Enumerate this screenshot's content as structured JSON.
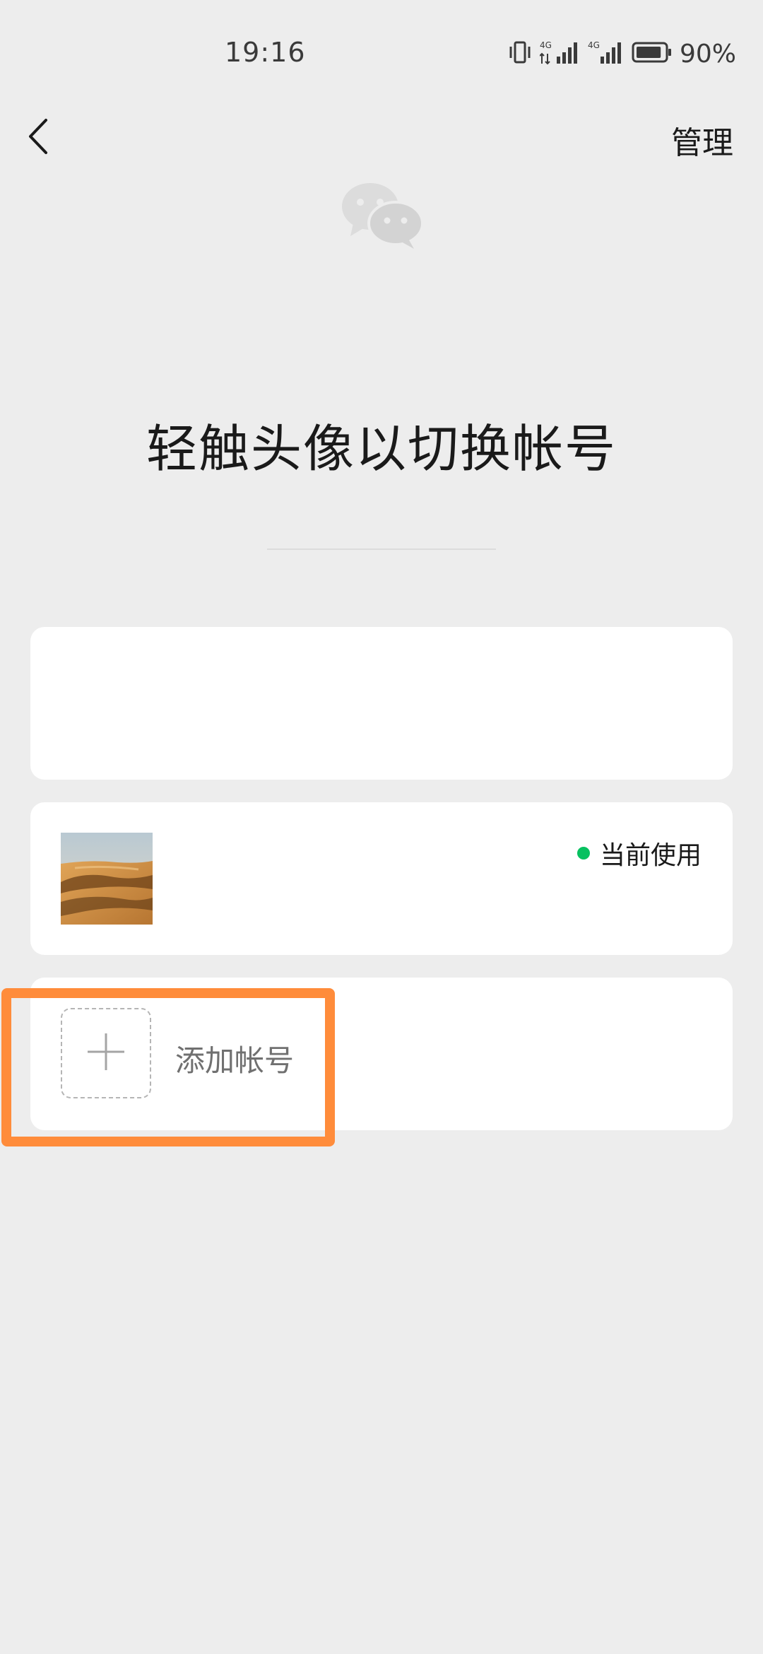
{
  "status_bar": {
    "time": "19:16",
    "signal_1_label": "4G",
    "signal_2_label": "4G",
    "battery_percent": "90%",
    "battery_level": 0.9
  },
  "nav": {
    "back_icon": "chevron-left-icon",
    "manage_label": "管理"
  },
  "logo_icon": "wechat-logo-icon",
  "title": "轻触头像以切换帐号",
  "accounts": [
    {
      "avatar": "desert-dunes-photo",
      "status_label": "当前使用",
      "status_color": "#07c160"
    }
  ],
  "add_account": {
    "icon": "plus-icon",
    "label": "添加帐号"
  },
  "colors": {
    "background": "#ededed",
    "card": "#ffffff",
    "accent_green": "#07c160",
    "highlight": "#ff8c3b"
  }
}
